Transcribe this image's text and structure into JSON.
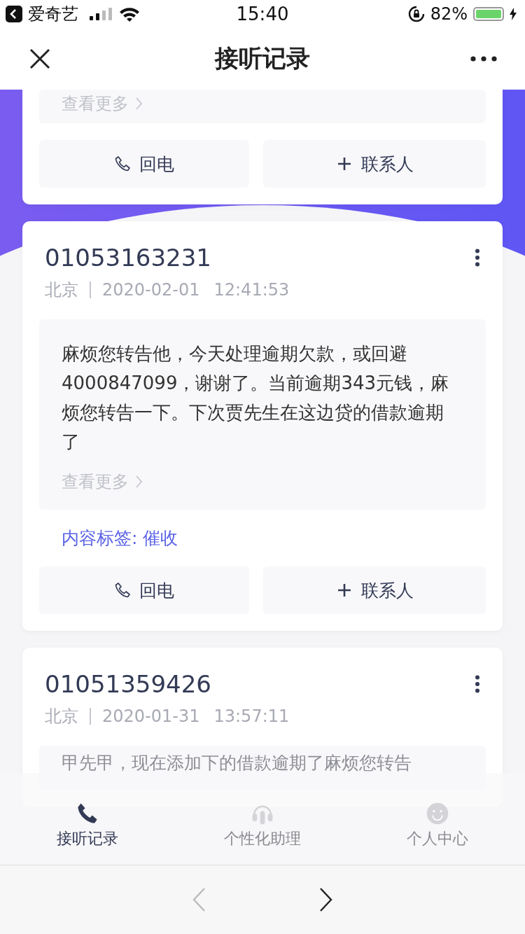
{
  "status_bar": {
    "back_app": "爱奇艺",
    "time": "15:40",
    "battery": "82%"
  },
  "header": {
    "title": "接听记录"
  },
  "records": [
    {
      "kind": "partial",
      "more_link": "查看更多",
      "actions": [
        "回电",
        "联系人"
      ]
    },
    {
      "kind": "full",
      "number": "01053163231",
      "location": "北京",
      "date": "2020-02-01",
      "time": "12:41:53",
      "message": "麻烦您转告他，今天处理逾期欠款，或回避4000847099，谢谢了。当前逾期343元钱，麻烦您转告一下。下次贾先生在这边贷的借款逾期了",
      "more_link": "查看更多",
      "tag_label": "内容标签:",
      "tag": "催收",
      "actions": [
        "回电",
        "联系人"
      ]
    },
    {
      "kind": "full",
      "number": "01051359426",
      "location": "北京",
      "date": "2020-01-31",
      "time": "13:57:11",
      "message": "甲先甲，现在添加下的借款逾期了麻烦您转告"
    }
  ],
  "tabs": [
    {
      "label": "接听记录",
      "selected": true
    },
    {
      "label": "个性化助理",
      "selected": false
    },
    {
      "label": "个人中心",
      "selected": false
    }
  ],
  "browser_nav": [
    {
      "kind": "back",
      "disabled": true
    },
    {
      "kind": "forward",
      "disabled": false
    }
  ]
}
